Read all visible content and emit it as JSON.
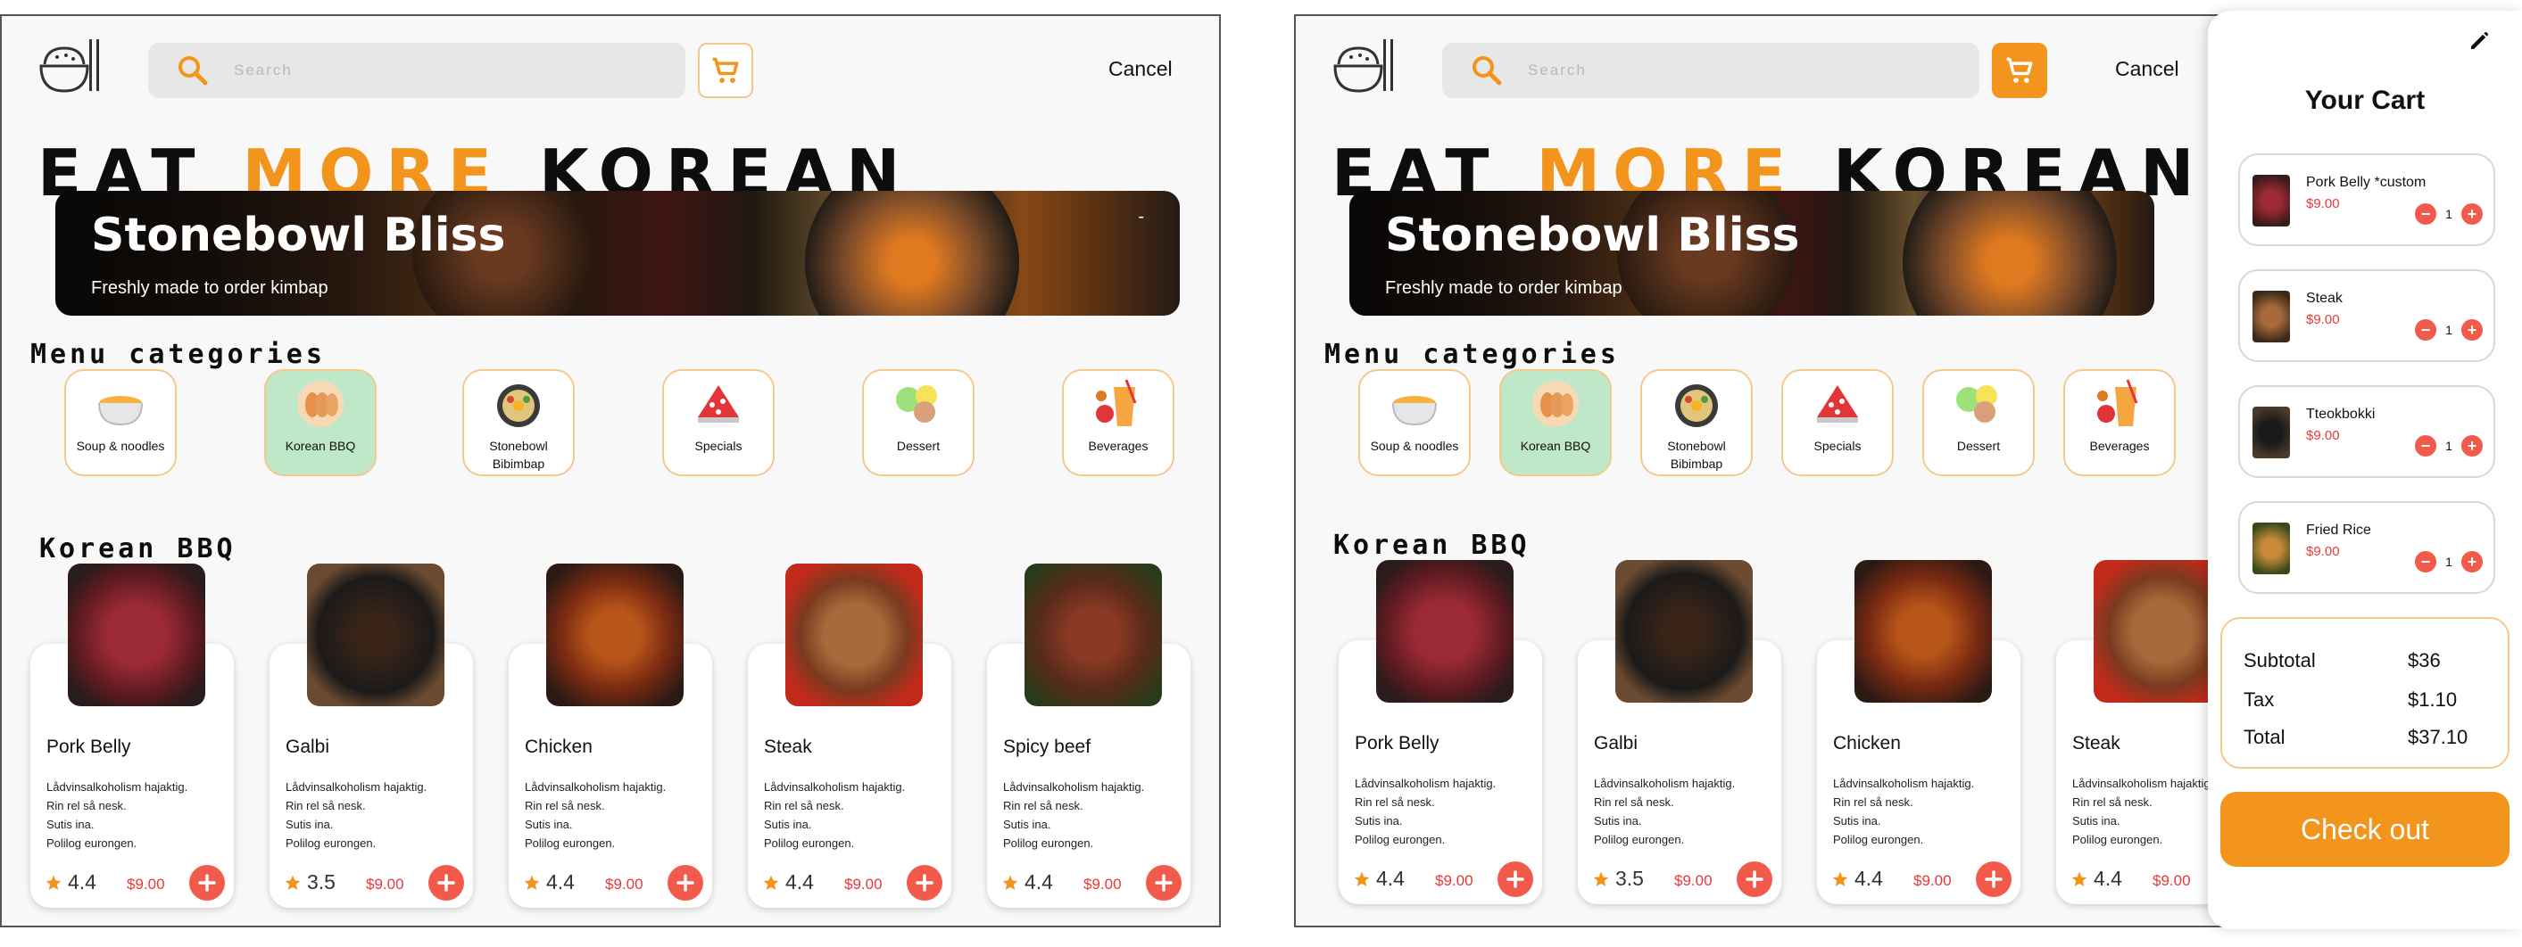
{
  "search": {
    "placeholder": "Search"
  },
  "header": {
    "cancel_label": "Cancel"
  },
  "hero": {
    "word1": "EAT ",
    "word2": "MORE",
    "word3": " KOREAN"
  },
  "banner": {
    "title": "Stonebowl Bliss",
    "subtitle": "Freshly made to order kimbap",
    "corner": "-"
  },
  "categories_title": "Menu categories",
  "categories": [
    {
      "label": "Soup & noodles",
      "icon": "soup-bowl-icon"
    },
    {
      "label": "Korean BBQ",
      "icon": "bbq-dumplings-icon",
      "selected": true
    },
    {
      "label": "Stonebowl Bibimbap",
      "icon": "bibimbap-pan-icon"
    },
    {
      "label": "Specials",
      "icon": "specials-dish-icon"
    },
    {
      "label": "Dessert",
      "icon": "dessert-icon"
    },
    {
      "label": "Beverages",
      "icon": "beverages-icon"
    }
  ],
  "section": {
    "title": "Korean BBQ"
  },
  "products": [
    {
      "name": "Pork Belly",
      "desc": [
        "Lådvinsalkoholism hajaktig.",
        "Rin rel så nesk.",
        "Sutis ina.",
        "Polilog eurongen."
      ],
      "rating": "4.4",
      "price": "$9.00"
    },
    {
      "name": "Galbi",
      "desc": [
        "Lådvinsalkoholism hajaktig.",
        "Rin rel så nesk.",
        "Sutis ina.",
        "Polilog eurongen."
      ],
      "rating": "3.5",
      "price": "$9.00"
    },
    {
      "name": "Chicken",
      "desc": [
        "Lådvinsalkoholism hajaktig.",
        "Rin rel så nesk.",
        "Sutis ina.",
        "Polilog eurongen."
      ],
      "rating": "4.4",
      "price": "$9.00"
    },
    {
      "name": "Steak",
      "desc": [
        "Lådvinsalkoholism hajaktig.",
        "Rin rel så nesk.",
        "Sutis ina.",
        "Polilog eurongen."
      ],
      "rating": "4.4",
      "price": "$9.00"
    },
    {
      "name": "Spicy beef",
      "desc": [
        "Lådvinsalkoholism hajaktig.",
        "Rin rel så nesk.",
        "Sutis ina.",
        "Polilog eurongen."
      ],
      "rating": "4.4",
      "price": "$9.00"
    }
  ],
  "cart": {
    "title": "Your Cart",
    "items": [
      {
        "name": "Pork Belly *custom",
        "price": "$9.00",
        "qty": "1"
      },
      {
        "name": "Steak",
        "price": "$9.00",
        "qty": "1"
      },
      {
        "name": "Tteokbokki",
        "price": "$9.00",
        "qty": "1"
      },
      {
        "name": "Fried Rice",
        "price": "$9.00",
        "qty": "1"
      }
    ],
    "subtotal_label": "Subtotal",
    "subtotal": "$36",
    "tax_label": "Tax",
    "tax": "$1.10",
    "total_label": "Total",
    "total": "$37.10",
    "checkout_label": "Check out",
    "minus": "−",
    "plus": "+"
  },
  "colors": {
    "accent": "#f3941c",
    "price": "#e83838",
    "add": "#f25a4c",
    "selected_cat": "#bfe8c8"
  }
}
